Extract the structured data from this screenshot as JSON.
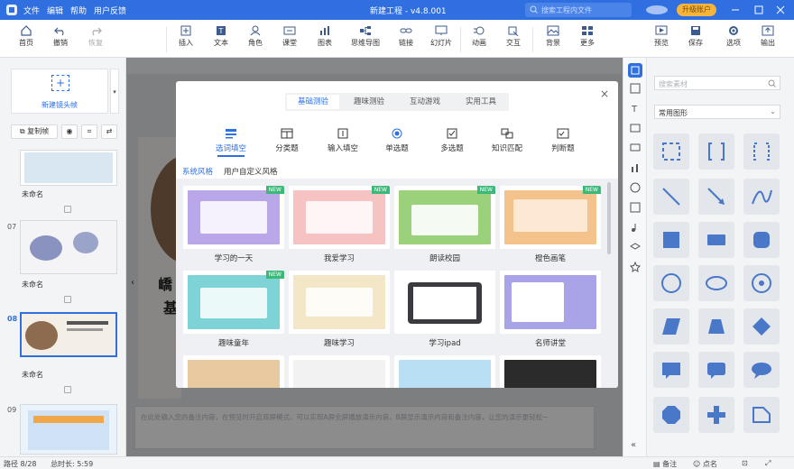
{
  "titlebar": {
    "menu": [
      "文件",
      "编辑",
      "帮助",
      "用户反馈"
    ],
    "title": "新建工程 - v4.8.001",
    "search_placeholder": "搜索工程内文件",
    "upgrade_label": "升级账户"
  },
  "toolbar": {
    "items": [
      "首页",
      "撤销",
      "恢复",
      "插入",
      "文本",
      "角色",
      "课堂",
      "图表",
      "思维导图",
      "链接",
      "幻灯片",
      "动画",
      "交互",
      "背景",
      "更多"
    ],
    "right_items": [
      "预览",
      "保存",
      "选项",
      "输出"
    ]
  },
  "left_panel": {
    "new_camera_label": "新建镜头帧",
    "copy_frame_label": "复制帧",
    "slides": [
      {
        "number": "",
        "name": "未命名"
      },
      {
        "number": "07",
        "name": "未命名"
      },
      {
        "number": "08",
        "name": "未命名",
        "selected": true
      },
      {
        "number": "09",
        "name": ""
      }
    ]
  },
  "canvas": {
    "text_fragments": [
      "嶠",
      "基"
    ],
    "notes_placeholder": "在此处输入您的备注内容，在预览时开启双屏模式，可以实现A屏全屏播放演示内容，B屏显示演示内容和备注内容，让您的演示更轻松~"
  },
  "right_panel": {
    "search_placeholder": "搜索素材",
    "category_selected": "常用图形"
  },
  "dialog": {
    "tabs": [
      "基础测验",
      "趣味测验",
      "互动游戏",
      "实用工具"
    ],
    "active_tab": "基础测验",
    "categories": [
      "选词填空",
      "分类题",
      "输入填空",
      "单选题",
      "多选题",
      "知识匹配",
      "判断题"
    ],
    "active_category": "选词填空",
    "style_tabs": [
      "系统风格",
      "用户自定义风格"
    ],
    "active_style": "系统风格",
    "templates": [
      {
        "name": "学习的一天",
        "new": true,
        "color": "#b9a7ea"
      },
      {
        "name": "我爱学习",
        "new": true,
        "color": "#f6c2c2"
      },
      {
        "name": "朗读校园",
        "new": true,
        "color": "#9bd17a"
      },
      {
        "name": "橙色画笔",
        "new": true,
        "color": "#f4c38b"
      },
      {
        "name": "趣味童年",
        "new": true,
        "color": "#7ed3d6"
      },
      {
        "name": "趣味学习",
        "new": false,
        "color": "#f3e7c8"
      },
      {
        "name": "学习ipad",
        "new": false,
        "color": "#3b3b3f"
      },
      {
        "name": "名师讲堂",
        "new": false,
        "color": "#a9a4e8"
      },
      {
        "name": "",
        "new": false,
        "color": "#e8c9a0"
      },
      {
        "name": "",
        "new": false,
        "color": "#f2f2f2"
      },
      {
        "name": "",
        "new": false,
        "color": "#b9dff5"
      },
      {
        "name": "",
        "new": false,
        "color": "#2b2b2b"
      }
    ]
  },
  "status": {
    "slide_counter": "路径 8/28",
    "total_time": "总时长: 5:59",
    "notes_label": "备注",
    "points_label": "点名"
  },
  "colors": {
    "accent": "#2f6fe0",
    "new_badge": "#3cb878"
  }
}
